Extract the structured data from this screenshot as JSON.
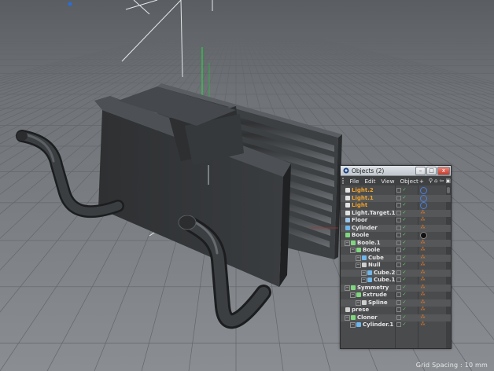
{
  "colors": {
    "viewport_bg": "#777b80",
    "grid_line": "#5e6267",
    "object_dark": "#2f3133",
    "object_mid": "#3c3f42",
    "object_light": "#55595d",
    "light_name": "#f0a32e",
    "y_axis": "#19e63a"
  },
  "status_bar": {
    "grid_spacing": "Grid Spacing : 10 mm"
  },
  "objects_window": {
    "title": "Objects (2)",
    "buttons": {
      "minimize": "–",
      "maximize": "□",
      "close": "x"
    },
    "menu": [
      "File",
      "Edit",
      "View",
      "Object"
    ],
    "menu_extra": "+",
    "tools": [
      "search-icon",
      "home-icon",
      "back-icon",
      "expand-icon"
    ],
    "rows": [
      {
        "name": "Light.2",
        "depth": 0,
        "color": "orange",
        "icon": "light-icon"
      },
      {
        "name": "Light.1",
        "depth": 0,
        "color": "orange",
        "icon": "light-icon"
      },
      {
        "name": "Light",
        "depth": 0,
        "color": "orange",
        "icon": "light-icon"
      },
      {
        "name": "Light.Target.1",
        "depth": 0,
        "color": "white",
        "icon": "target-icon"
      },
      {
        "name": "Floor",
        "depth": 0,
        "color": "white",
        "icon": "floor-icon"
      },
      {
        "name": "Cylinder",
        "depth": 0,
        "color": "white",
        "icon": "cylinder-icon"
      },
      {
        "name": "Boole",
        "depth": 0,
        "color": "white",
        "icon": "boole-icon"
      },
      {
        "name": "Boole.1",
        "depth": 1,
        "color": "white",
        "icon": "boole-icon"
      },
      {
        "name": "Boole",
        "depth": 2,
        "color": "white",
        "icon": "boole-icon"
      },
      {
        "name": "Cube",
        "depth": 3,
        "color": "white",
        "icon": "cube-icon"
      },
      {
        "name": "Null",
        "depth": 3,
        "color": "white",
        "icon": "null-icon"
      },
      {
        "name": "Cube.2",
        "depth": 4,
        "color": "white",
        "icon": "cube-icon"
      },
      {
        "name": "Cube.1",
        "depth": 4,
        "color": "white",
        "icon": "cube-icon"
      },
      {
        "name": "Symmetry",
        "depth": 1,
        "color": "white",
        "icon": "symmetry-icon"
      },
      {
        "name": "Extrude",
        "depth": 2,
        "color": "white",
        "icon": "extrude-icon"
      },
      {
        "name": "Spline",
        "depth": 3,
        "color": "white",
        "icon": "spline-icon"
      },
      {
        "name": "prese",
        "depth": 0,
        "color": "white",
        "icon": "null-icon"
      },
      {
        "name": "Cloner",
        "depth": 1,
        "color": "white",
        "icon": "cloner-icon"
      },
      {
        "name": "Cylinder.1",
        "depth": 2,
        "color": "white",
        "icon": "cylinder-icon"
      }
    ]
  }
}
